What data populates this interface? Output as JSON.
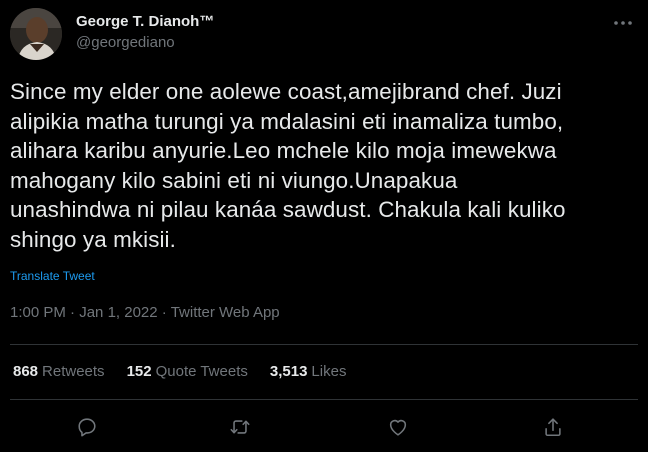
{
  "author": {
    "display_name": "George T. Dianoh™",
    "handle": "@georgediano"
  },
  "tweet": {
    "lines": [
      "Since my elder one aolewe coast,amejibrand chef. Juzi",
      "alipikia matha turungi ya mdalasini eti inamaliza tumbo,",
      "alihara karibu anyurie.Leo mchele kilo moja imewekwa",
      "mahogany kilo sabini eti ni viungo.Unapakua",
      "unashindwa ni pilau kanáa sawdust. Chakula kali kuliko",
      "shingo ya mkisii."
    ],
    "translate_label": "Translate Tweet",
    "time": "1:00 PM",
    "date": "Jan 1, 2022",
    "source": "Twitter Web App"
  },
  "stats": {
    "retweets_count": "868",
    "retweets_label": "Retweets",
    "quotes_count": "152",
    "quotes_label": "Quote Tweets",
    "likes_count": "3,513",
    "likes_label": "Likes"
  },
  "icons": {
    "more": "more-dots-icon",
    "reply": "reply-icon",
    "retweet": "retweet-icon",
    "like": "heart-icon",
    "share": "share-icon"
  },
  "colors": {
    "background": "#000000",
    "text": "#e7e9ea",
    "secondary": "#71767b",
    "link": "#1d9bf0",
    "divider": "#2f3336"
  }
}
